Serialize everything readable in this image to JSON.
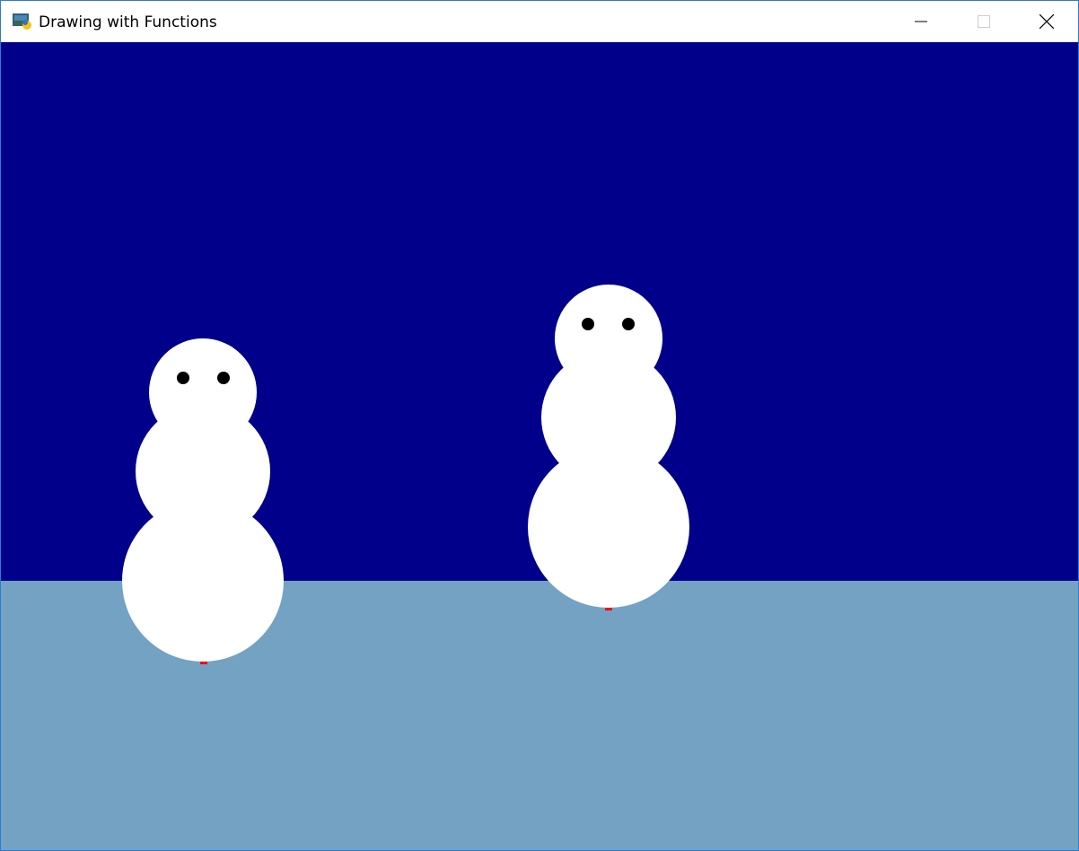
{
  "window": {
    "title": "Drawing with Functions",
    "controls": {
      "minimize_icon": "minimize-icon",
      "maximize_icon": "maximize-icon",
      "close_icon": "close-icon"
    }
  },
  "scene": {
    "sky_color": "#00008b",
    "ground_color": "#73a2c2",
    "snowman_color": "#ffffff",
    "eye_color": "#000000",
    "marker_color": "#ff0000",
    "snowmen_count": 2
  }
}
